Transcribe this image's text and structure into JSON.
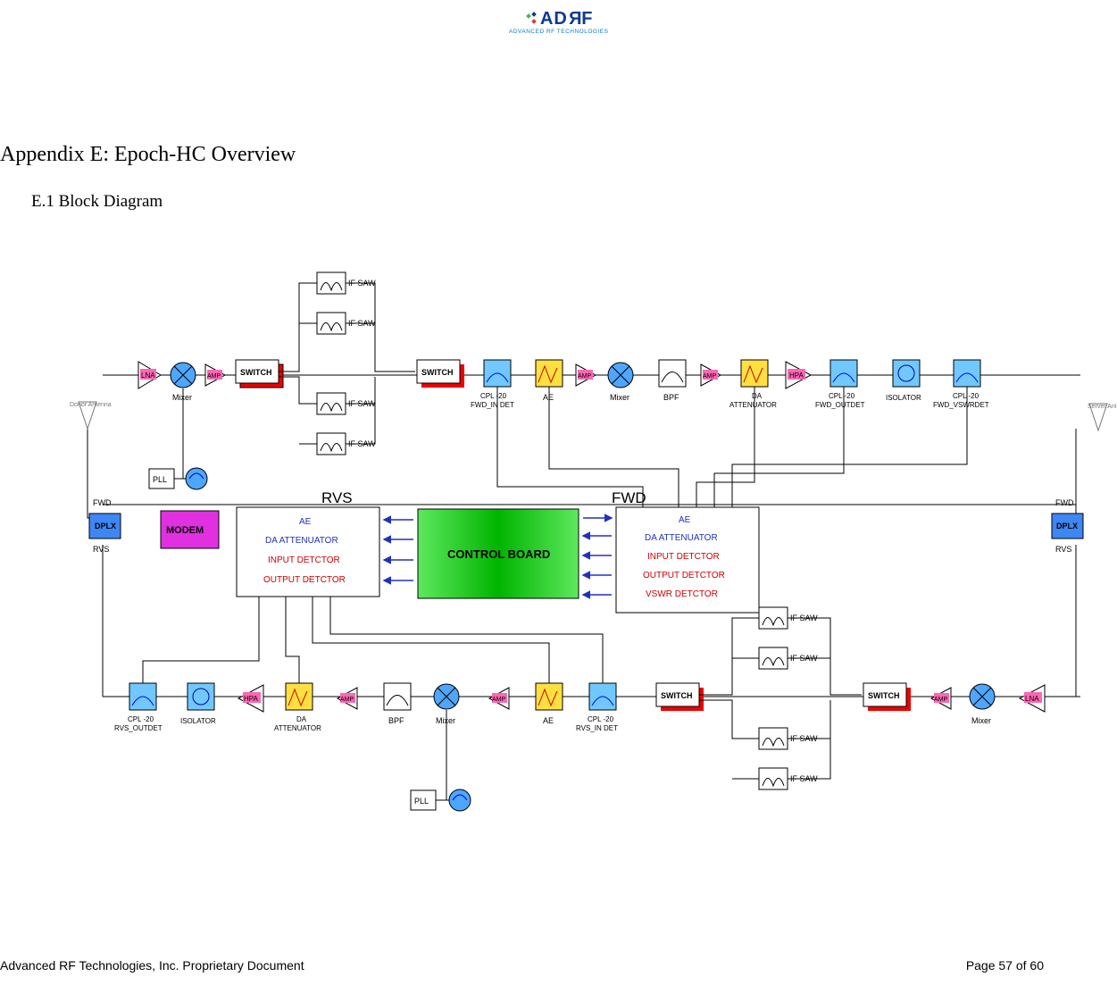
{
  "logo": {
    "brand": "ADRF",
    "sub": "ADVANCED RF TECHNOLOGIES"
  },
  "title": "Appendix E: Epoch-HC Overview",
  "subtitle": "E.1 Block Diagram",
  "footer": {
    "left": "Advanced RF Technologies, Inc. Proprietary Document",
    "right": "Page 57 of 60"
  },
  "diagram": {
    "antennas": {
      "left": "Donor\nAntenna",
      "right": "Server\nAntenna"
    },
    "amps": {
      "lna": "LNA",
      "amp": "AMP",
      "hpa": "HPA"
    },
    "mixer": "Mixer",
    "switch": "SWITCH",
    "if_saw": "IF SAW",
    "pll": "PLL",
    "fwd": "FWD",
    "rvs": "RVS",
    "dplx": "DPLX",
    "modem": "MODEM",
    "control_board": "CONTROL BOARD",
    "rvs_block": {
      "ae": "AE",
      "da": "DA  ATTENUATOR",
      "in": "INPUT  DETCTOR",
      "out": "OUTPUT  DETCTOR"
    },
    "fwd_block": {
      "ae": "AE",
      "da": "DA  ATTENUATOR",
      "in": "INPUT  DETCTOR",
      "out": "OUTPUT  DETCTOR",
      "vswr": "VSWR  DETCTOR"
    },
    "top_labels": {
      "cpl_fwd_in": "CPL -20\nFWD_IN DET",
      "ae": "AE",
      "bpf": "BPF",
      "da_att": "DA\nATTENUATOR",
      "cpl_fwd_out": "CPL -20\nFWD_OUTDET",
      "isolator": "ISOLATOR",
      "cpl_fwd_vswr": "CPL -20\nFWD_VSWRDET"
    },
    "bot_labels": {
      "cpl_rvs_out": "CPL -20\nRVS_OUTDET",
      "isolator": "ISOLATOR",
      "da_att": "DA\nATTENUATOR",
      "bpf": "BPF",
      "mixer": "Mixer",
      "ae": "AE",
      "cpl_rvs_in": "CPL -20\nRVS_IN DET"
    }
  }
}
